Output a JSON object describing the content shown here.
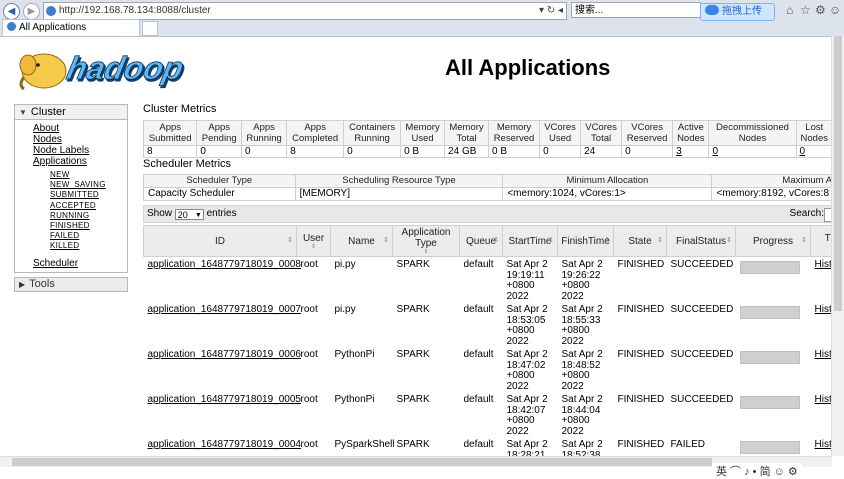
{
  "browser": {
    "url": "http://192.168.78.134:8088/cluster",
    "search_placeholder": "搜索...",
    "upload_label": "拖拽上传",
    "tab_title": "All Applications"
  },
  "page": {
    "title": "All Applications"
  },
  "sidebar": {
    "cluster_label": "Cluster",
    "about": "About",
    "nodes": "Nodes",
    "node_labels": "Node Labels",
    "applications": "Applications",
    "states": [
      "NEW",
      "NEW_SAVING",
      "SUBMITTED",
      "ACCEPTED",
      "RUNNING",
      "FINISHED",
      "FAILED",
      "KILLED"
    ],
    "scheduler": "Scheduler",
    "tools_label": "Tools"
  },
  "cluster_metrics": {
    "title": "Cluster Metrics",
    "headers": [
      [
        "Apps",
        "Submitted"
      ],
      [
        "Apps",
        "Pending"
      ],
      [
        "Apps",
        "Running"
      ],
      [
        "Apps",
        "Completed"
      ],
      [
        "Containers",
        "Running"
      ],
      [
        "Memory",
        "Used"
      ],
      [
        "Memory",
        "Total"
      ],
      [
        "Memory",
        "Reserved"
      ],
      [
        "VCores",
        "Used"
      ],
      [
        "VCores",
        "Total"
      ],
      [
        "VCores",
        "Reserved"
      ],
      [
        "Active",
        "Nodes"
      ],
      [
        "Decommissioned",
        "Nodes"
      ],
      [
        "Lost",
        "Nodes"
      ]
    ],
    "values": [
      "8",
      "0",
      "0",
      "8",
      "0",
      "0 B",
      "24 GB",
      "0 B",
      "0",
      "24",
      "0",
      "3",
      "0",
      "0"
    ]
  },
  "scheduler_metrics": {
    "title": "Scheduler Metrics",
    "headers": [
      "Scheduler Type",
      "Scheduling Resource Type",
      "Minimum Allocation",
      "Maximum A"
    ],
    "values": [
      "Capacity Scheduler",
      "[MEMORY]",
      "<memory:1024, vCores:1>",
      "<memory:8192, vCores:8"
    ]
  },
  "table_controls": {
    "show": "Show",
    "entries_count": "20",
    "entries": "entries",
    "search": "Search:"
  },
  "apps_table": {
    "headers": [
      "ID",
      "User",
      "Name",
      "Application Type",
      "Queue",
      "StartTime",
      "FinishTime",
      "State",
      "FinalStatus",
      "Progress",
      "Tra U"
    ],
    "rows": [
      {
        "id": "application_1648779718019_0008",
        "user": "root",
        "name": "pi.py",
        "type": "SPARK",
        "queue": "default",
        "start": [
          "Sat Apr 2",
          "19:19:11",
          "+0800",
          "2022"
        ],
        "finish": [
          "Sat Apr 2",
          "19:26:22",
          "+0800",
          "2022"
        ],
        "state": "FINISHED",
        "final": "SUCCEEDED",
        "progress": 1.0,
        "tracking": "Histo"
      },
      {
        "id": "application_1648779718019_0007",
        "user": "root",
        "name": "pi.py",
        "type": "SPARK",
        "queue": "default",
        "start": [
          "Sat Apr 2",
          "18:53:05",
          "+0800",
          "2022"
        ],
        "finish": [
          "Sat Apr 2",
          "18:55:33",
          "+0800",
          "2022"
        ],
        "state": "FINISHED",
        "final": "SUCCEEDED",
        "progress": 1.0,
        "tracking": "Histo"
      },
      {
        "id": "application_1648779718019_0006",
        "user": "root",
        "name": "PythonPi",
        "type": "SPARK",
        "queue": "default",
        "start": [
          "Sat Apr 2",
          "18:47:02",
          "+0800",
          "2022"
        ],
        "finish": [
          "Sat Apr 2",
          "18:48:52",
          "+0800",
          "2022"
        ],
        "state": "FINISHED",
        "final": "SUCCEEDED",
        "progress": 1.0,
        "tracking": "Histo"
      },
      {
        "id": "application_1648779718019_0005",
        "user": "root",
        "name": "PythonPi",
        "type": "SPARK",
        "queue": "default",
        "start": [
          "Sat Apr 2",
          "18:42:07",
          "+0800",
          "2022"
        ],
        "finish": [
          "Sat Apr 2",
          "18:44:04",
          "+0800",
          "2022"
        ],
        "state": "FINISHED",
        "final": "SUCCEEDED",
        "progress": 1.0,
        "tracking": "Histo"
      },
      {
        "id": "application_1648779718019_0004",
        "user": "root",
        "name": "PySparkShell",
        "type": "SPARK",
        "queue": "default",
        "start": [
          "Sat Apr 2",
          "18:28:21"
        ],
        "finish": [
          "Sat Apr 2",
          "18:52:38"
        ],
        "state": "FINISHED",
        "final": "FAILED",
        "progress": 1.0,
        "tracking": "Histo"
      }
    ]
  },
  "taskbar": {
    "ime": "英 ⌒ ♪ • 简 ☺ ⚙"
  }
}
